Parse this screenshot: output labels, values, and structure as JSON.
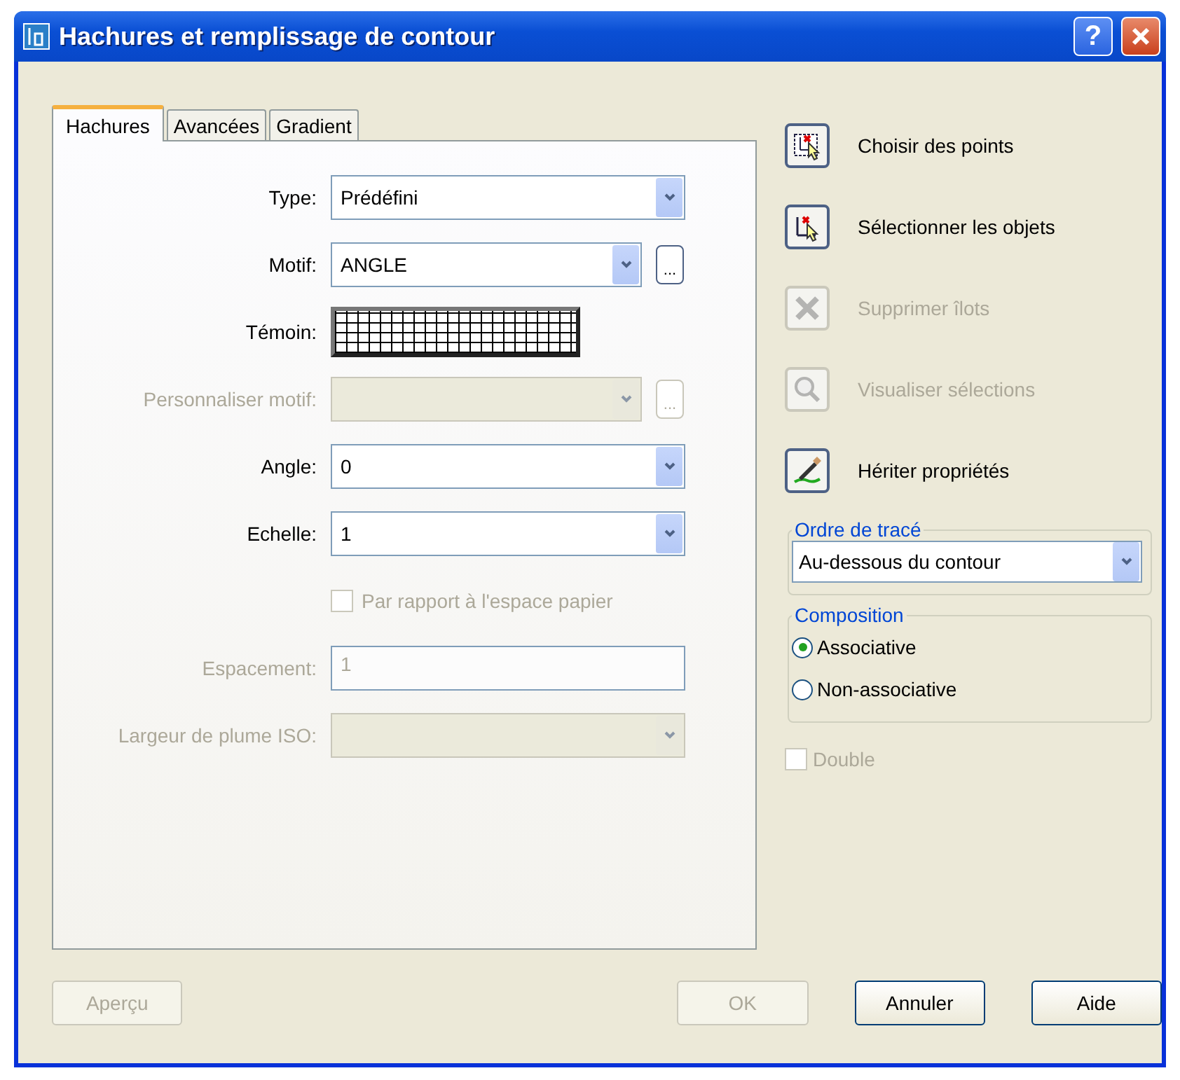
{
  "window": {
    "title": "Hachures et remplissage de contour",
    "help": "?"
  },
  "tabs": [
    {
      "label": "Hachures",
      "selected": true
    },
    {
      "label": "Avancées",
      "selected": false
    },
    {
      "label": "Gradient",
      "selected": false
    }
  ],
  "fields": [
    {
      "kind": "combo",
      "label": "Type:",
      "value": "Prédéfini",
      "disabled": false
    },
    {
      "kind": "combo",
      "label": "Motif:",
      "value": "ANGLE",
      "disabled": false,
      "browse": "..."
    },
    {
      "kind": "pattern",
      "label": "Témoin:",
      "disabled": false
    },
    {
      "kind": "combo",
      "label": "Personnaliser motif:",
      "disabled": true,
      "browse": "..."
    },
    {
      "kind": "combo",
      "label": "Angle:",
      "value": "0",
      "disabled": false
    },
    {
      "kind": "combo",
      "label": "Echelle:",
      "value": "1",
      "disabled": false
    },
    {
      "kind": "checkbox",
      "label": "Par rapport à l'espace papier",
      "checked": false,
      "disabled": true
    },
    {
      "kind": "text",
      "label": "Espacement:",
      "value": "1",
      "disabled": true
    },
    {
      "kind": "combo",
      "label": "Largeur de plume ISO:",
      "disabled": true
    }
  ],
  "actions": [
    {
      "label": "Choisir des points",
      "disabled": false
    },
    {
      "label": "Sélectionner les objets",
      "disabled": false
    },
    {
      "label": "Supprimer îlots",
      "disabled": true
    },
    {
      "label": "Visualiser sélections",
      "disabled": true
    },
    {
      "label": "Hériter propriétés",
      "disabled": false
    }
  ],
  "draw_order": {
    "title": "Ordre de tracé",
    "value": "Au-dessous du contour"
  },
  "composition": {
    "title": "Composition",
    "options": [
      {
        "label": "Associative",
        "selected": true
      },
      {
        "label": "Non-associative",
        "selected": false
      }
    ]
  },
  "double": {
    "label": "Double",
    "checked": false,
    "disabled": true
  },
  "buttons": [
    {
      "label": "Aperçu",
      "disabled": true
    },
    {
      "label": "OK",
      "disabled": true
    },
    {
      "label": "Annuler",
      "disabled": false
    },
    {
      "label": "Aide",
      "disabled": false
    }
  ]
}
